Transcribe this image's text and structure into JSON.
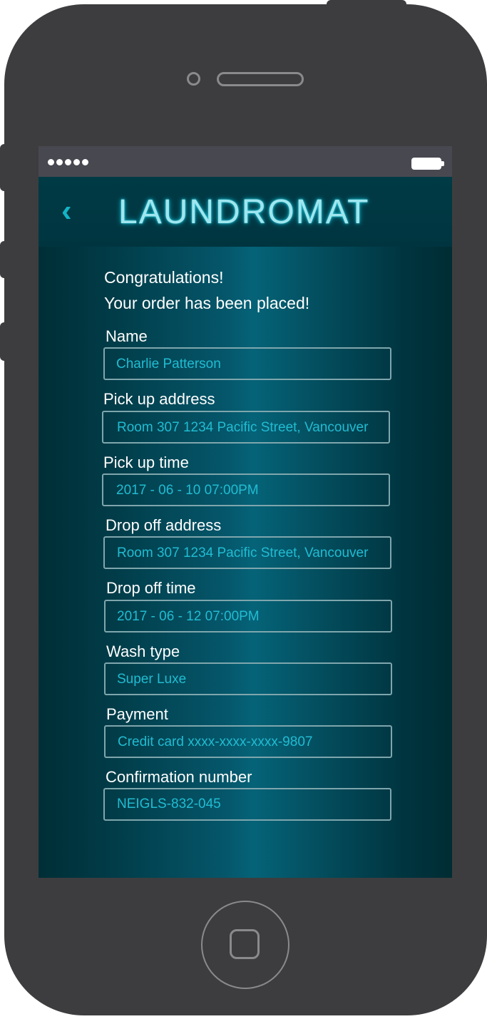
{
  "app": {
    "title": "LAUNDROMAT",
    "back_glyph": "‹"
  },
  "status_bar": {
    "signal_dots": 5,
    "battery_icon": "battery-full-icon"
  },
  "message": {
    "line1": "Congratulations!",
    "line2": "Your order has been placed!"
  },
  "fields": [
    {
      "label": "Name",
      "value": "Charlie Patterson"
    },
    {
      "label": "Pick up address",
      "value": "Room 307 1234 Pacific Street, Vancouver"
    },
    {
      "label": "Pick up time",
      "value": "2017 - 06 - 10   07:00PM"
    },
    {
      "label": "Drop off address",
      "value": "Room 307 1234 Pacific Street, Vancouver"
    },
    {
      "label": "Drop off time",
      "value": "2017 - 06 - 12   07:00PM"
    },
    {
      "label": "Wash type",
      "value": "Super Luxe"
    },
    {
      "label": "Payment",
      "value": "Credit card xxxx-xxxx-xxxx-9807"
    },
    {
      "label": "Confirmation number",
      "value": "NEIGLS-832-045"
    }
  ],
  "colors": {
    "accent": "#14b3c7",
    "field_text": "#21bcd2",
    "phone_body": "#3d3d3f",
    "status_bar": "#484851"
  }
}
